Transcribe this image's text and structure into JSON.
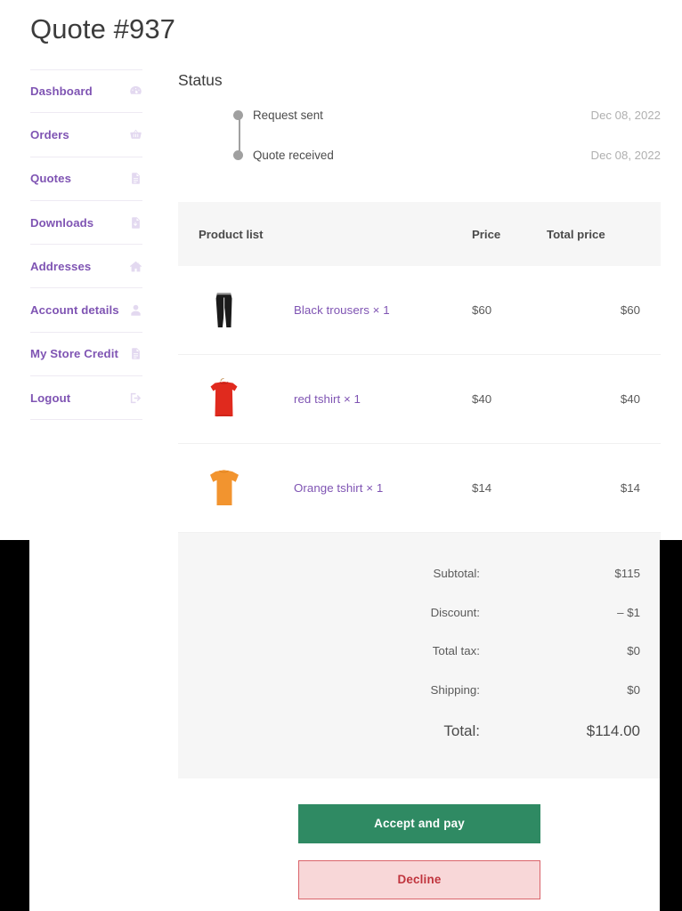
{
  "page": {
    "title": "Quote #937"
  },
  "sidebar": {
    "items": [
      {
        "label": "Dashboard",
        "icon": "gauge-icon"
      },
      {
        "label": "Orders",
        "icon": "basket-icon"
      },
      {
        "label": "Quotes",
        "icon": "document-icon"
      },
      {
        "label": "Downloads",
        "icon": "download-document-icon"
      },
      {
        "label": "Addresses",
        "icon": "home-icon"
      },
      {
        "label": "Account details",
        "icon": "user-icon"
      },
      {
        "label": "My Store Credit",
        "icon": "document-icon"
      },
      {
        "label": "Logout",
        "icon": "logout-icon"
      }
    ]
  },
  "status": {
    "heading": "Status",
    "events": [
      {
        "label": "Request sent",
        "date": "Dec 08, 2022"
      },
      {
        "label": "Quote received",
        "date": "Dec 08, 2022"
      }
    ]
  },
  "products": {
    "columns": {
      "product": "Product list",
      "price": "Price",
      "total": "Total price"
    },
    "rows": [
      {
        "name": "Black trousers × 1",
        "price": "$60",
        "total": "$60",
        "image": "black-trousers-thumbnail"
      },
      {
        "name": "red tshirt × 1",
        "price": "$40",
        "total": "$40",
        "image": "red-tshirt-thumbnail"
      },
      {
        "name": "Orange tshirt × 1",
        "price": "$14",
        "total": "$14",
        "image": "orange-tshirt-thumbnail"
      }
    ]
  },
  "totals": [
    {
      "label": "Subtotal:",
      "value": "$115"
    },
    {
      "label": "Discount:",
      "value": "– $1"
    },
    {
      "label": "Total tax:",
      "value": "$0"
    },
    {
      "label": "Shipping:",
      "value": "$0"
    },
    {
      "label": "Total:",
      "value": "$114.00"
    }
  ],
  "actions": {
    "accept": "Accept and pay",
    "decline": "Decline"
  },
  "colors": {
    "accent_purple": "#7f54b3",
    "accept_green": "#2f8a63",
    "decline_pink": "#f8d7d8",
    "decline_text": "#c0343d",
    "panel_gray": "#f6f6f6"
  }
}
